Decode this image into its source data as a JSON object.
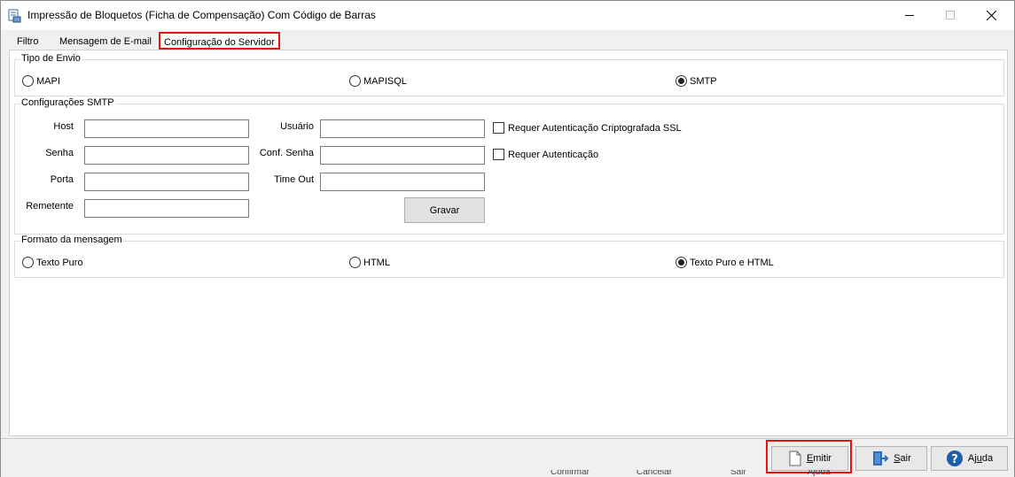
{
  "window": {
    "title": "Impressão  de Bloquetos (Ficha de Compensação) Com Código de Barras",
    "controls": {
      "minimize": "—",
      "maximize": "☐",
      "close": "✕"
    }
  },
  "tabs": [
    {
      "label": "Filtro",
      "active": false
    },
    {
      "label": "Mensagem de E-mail",
      "active": false
    },
    {
      "label": "Configuração do Servidor",
      "active": true
    }
  ],
  "tipo_envio": {
    "legend": "Tipo de Envio",
    "options": [
      {
        "label": "MAPI",
        "selected": false
      },
      {
        "label": "MAPISQL",
        "selected": false
      },
      {
        "label": "SMTP",
        "selected": true
      }
    ]
  },
  "smtp": {
    "legend": "Configurações SMTP",
    "host": {
      "label": "Host",
      "value": ""
    },
    "senha": {
      "label": "Senha",
      "value": ""
    },
    "porta": {
      "label": "Porta",
      "value": ""
    },
    "remetente": {
      "label": "Remetente",
      "value": ""
    },
    "usuario": {
      "label": "Usuário",
      "value": ""
    },
    "conf_senha": {
      "label": "Conf. Senha",
      "value": ""
    },
    "time_out": {
      "label": "Time Out",
      "value": ""
    },
    "ssl_check": {
      "label": "Requer Autenticação Criptografada SSL",
      "checked": false
    },
    "auth_check": {
      "label": "Requer Autenticação",
      "checked": false
    },
    "gravar_label": "Gravar"
  },
  "formato": {
    "legend": "Formato da mensagem",
    "options": [
      {
        "label": "Texto Puro",
        "selected": false
      },
      {
        "label": "HTML",
        "selected": false
      },
      {
        "label": "Texto Puro e HTML",
        "selected": true
      }
    ]
  },
  "footer": {
    "emitir": {
      "rest": "mitir",
      "accel": "E"
    },
    "sair": {
      "rest": "air",
      "accel": "S"
    },
    "ajuda": {
      "pre": "Aj",
      "accel": "u",
      "rest": "da"
    }
  },
  "behind": {
    "confirmar": "Confirmar",
    "cancelar": "Cancelar",
    "sair": "Sair",
    "ajuda": "Ajuda"
  },
  "colors": {
    "highlight": "#e11111",
    "window_bg": "#f0f0f0",
    "panel_bg": "#ffffff"
  }
}
